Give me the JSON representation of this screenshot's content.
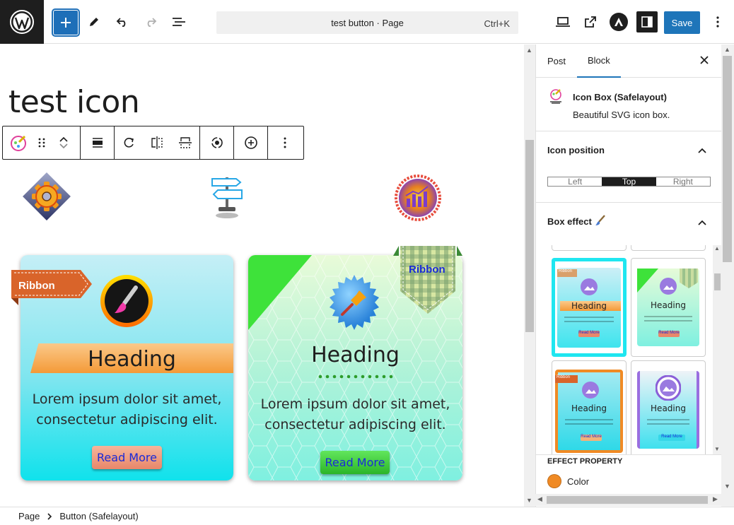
{
  "topbar": {
    "doc_title": "test button · Page",
    "shortcut": "Ctrl+K",
    "save_label": "Save"
  },
  "canvas": {
    "page_title": "test icon",
    "card1": {
      "ribbon": "Ribbon",
      "heading": "Heading",
      "text_line1": "Lorem ipsum dolor sit amet,",
      "text_line2": "consectetur adipiscing elit.",
      "button": "Read More"
    },
    "card2": {
      "ribbon": "Ribbon",
      "heading": "Heading",
      "text_line1": "Lorem ipsum dolor sit amet,",
      "text_line2": "consectetur adipiscing elit.",
      "button": "Read More"
    }
  },
  "sidebar": {
    "tabs": [
      "Post",
      "Block"
    ],
    "active_tab": "Block",
    "block_name": "Icon Box (Safelayout)",
    "block_desc": "Beautiful SVG icon box.",
    "icon_position": {
      "title": "Icon position",
      "options": [
        "Left",
        "Top",
        "Right"
      ],
      "selected": "Top"
    },
    "box_effect": {
      "title": "Box effect",
      "thumbs": [
        {
          "ribbon": "Ribbon",
          "heading": "Heading",
          "button": "Read More"
        },
        {
          "heading": "Heading",
          "button": "Read More"
        },
        {
          "ribbon": "Ribbon",
          "heading": "Heading",
          "button": "Read More"
        },
        {
          "heading": "Heading",
          "button": "Read More"
        }
      ]
    },
    "effect_property": {
      "title": "EFFECT PROPERTY",
      "color_label": "Color",
      "color_value": "#f08a24"
    }
  },
  "footer": {
    "breadcrumb": [
      "Page",
      "Button (Safelayout)"
    ]
  },
  "colors": {
    "accent": "#1e75b9",
    "selected_thumb": "#1fe6f0"
  }
}
